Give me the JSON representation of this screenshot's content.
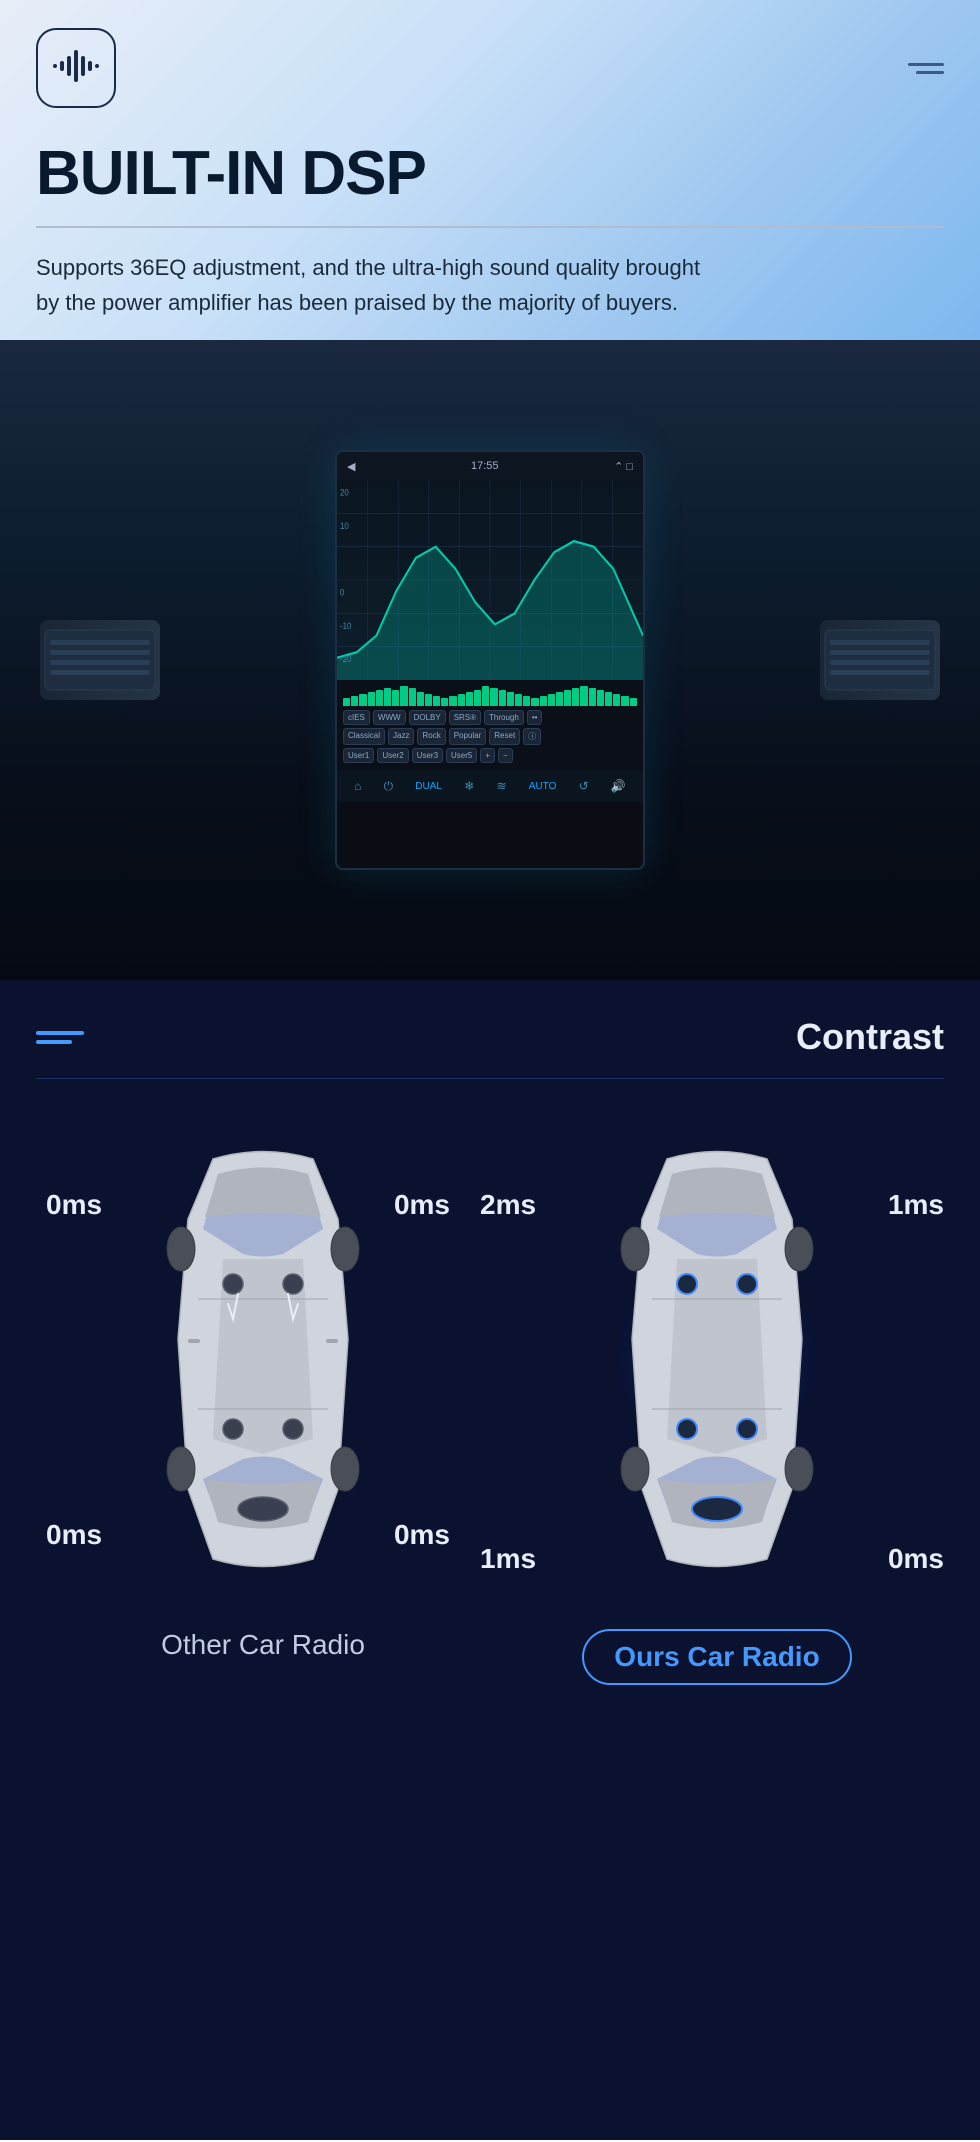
{
  "header": {
    "title": "BUILT-IN DSP",
    "description": "Supports 36EQ adjustment, and the ultra-high sound quality brought by the power amplifier has been praised by the majority of buyers.",
    "logo_alt": "audio-logo"
  },
  "hamburger": {
    "alt": "menu"
  },
  "dsp_screen": {
    "time": "17:55",
    "buttons": [
      "cIES",
      "WWW",
      "DOLBY",
      "SRS®",
      "Through",
      "••",
      "Classical",
      "Jazz",
      "Rock",
      "Popular",
      "Reset",
      "ⓘ",
      "User1",
      "User2",
      "User3",
      "User5",
      "+",
      "−"
    ]
  },
  "contrast": {
    "title": "Contrast",
    "other_car": {
      "label": "Other Car Radio",
      "timings": {
        "top_left": "0ms",
        "top_right": "0ms",
        "bottom_left": "0ms",
        "bottom_right": "0ms"
      }
    },
    "ours_car": {
      "label": "Ours Car Radio",
      "timings": {
        "top_left": "2ms",
        "top_right": "1ms",
        "bottom_left": "1ms",
        "bottom_right": "0ms"
      }
    }
  }
}
